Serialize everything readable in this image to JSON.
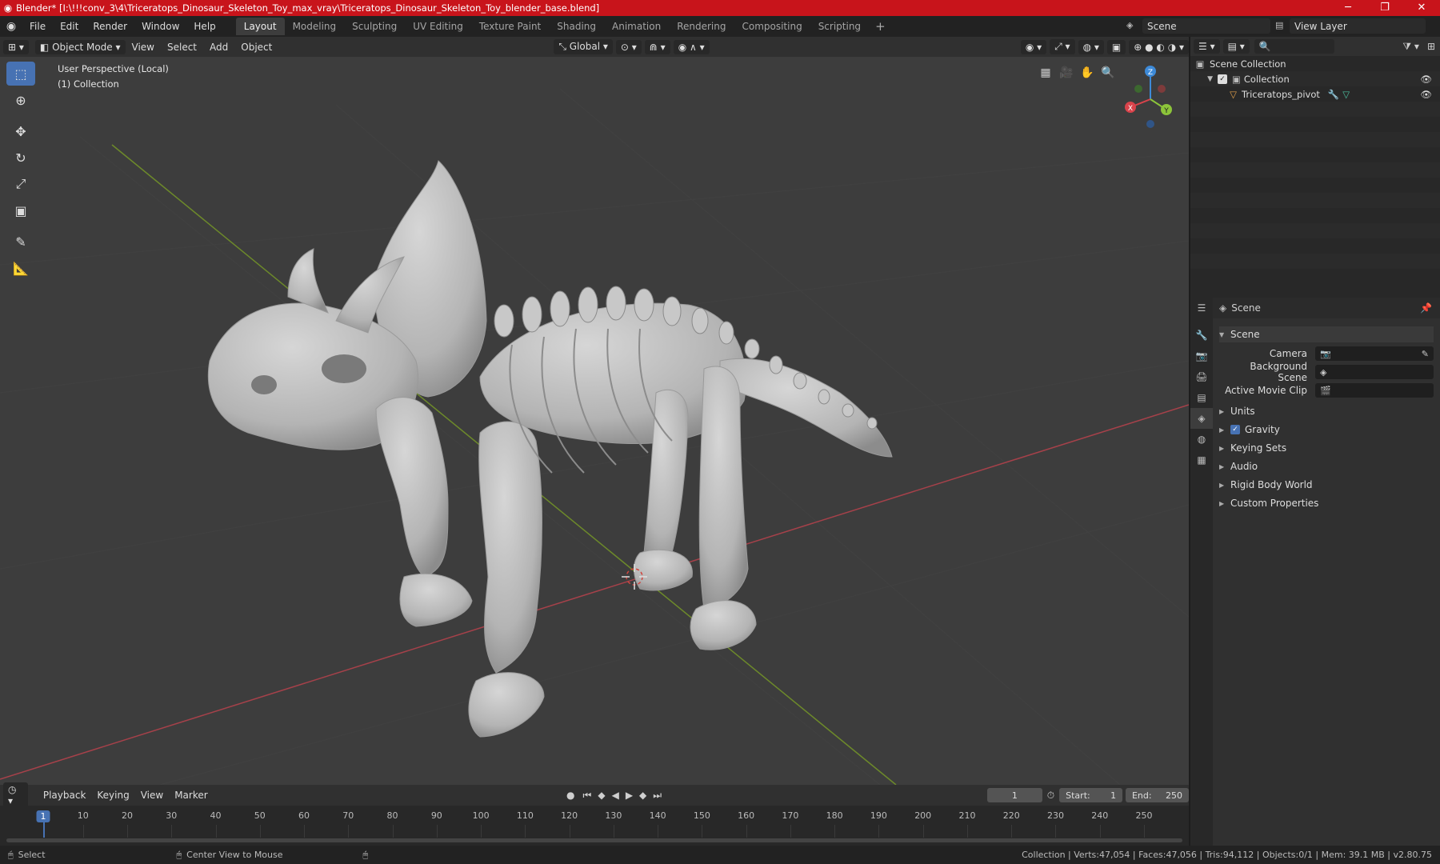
{
  "titlebar": {
    "title": "Blender* [I:\\!!!conv_3\\4\\Triceratops_Dinosaur_Skeleton_Toy_max_vray\\Triceratops_Dinosaur_Skeleton_Toy_blender_base.blend]",
    "minimize": "─",
    "maximize": "❐",
    "close": "✕"
  },
  "menu": {
    "items": [
      "File",
      "Edit",
      "Render",
      "Window",
      "Help"
    ],
    "workspaces": [
      "Layout",
      "Modeling",
      "Sculpting",
      "UV Editing",
      "Texture Paint",
      "Shading",
      "Animation",
      "Rendering",
      "Compositing",
      "Scripting"
    ],
    "active_workspace": "Layout",
    "add": "+",
    "scene": "Scene",
    "view_layer": "View Layer"
  },
  "viewport_header": {
    "mode": "Object Mode",
    "menus": [
      "View",
      "Select",
      "Add",
      "Object"
    ],
    "orientation": "Global"
  },
  "viewport": {
    "perspective": "User Perspective (Local)",
    "collection": "(1) Collection",
    "axes": {
      "x": "X",
      "y": "Y",
      "z": "Z"
    }
  },
  "timeline": {
    "menus": [
      "Playback",
      "Keying",
      "View",
      "Marker"
    ],
    "current_frame": "1",
    "start_label": "Start:",
    "start": "1",
    "end_label": "End:",
    "end": "250",
    "ticks": [
      "1",
      "10",
      "20",
      "30",
      "40",
      "50",
      "60",
      "70",
      "80",
      "90",
      "100",
      "110",
      "120",
      "130",
      "140",
      "150",
      "160",
      "170",
      "180",
      "190",
      "200",
      "210",
      "220",
      "230",
      "240",
      "250"
    ]
  },
  "outliner": {
    "scene_collection": "Scene Collection",
    "collection": "Collection",
    "object": "Triceratops_pivot"
  },
  "properties": {
    "header": "Scene",
    "panel": "Scene",
    "camera_label": "Camera",
    "background_label": "Background Scene",
    "movie_clip_label": "Active Movie Clip",
    "subpanels": [
      "Units",
      "Gravity",
      "Keying Sets",
      "Audio",
      "Rigid Body World",
      "Custom Properties"
    ]
  },
  "status": {
    "select": "Select",
    "center": "Center View to Mouse",
    "stats": "Collection | Verts:47,054 | Faces:47,056 | Tris:94,112 | Objects:0/1 | Mem: 39.1 MB | v2.80.75"
  },
  "colors": {
    "titlebar": "#c8141b",
    "accent": "#4772b3",
    "x_axis": "#d9434b",
    "y_axis": "#8cc43a",
    "z_axis": "#3d8ad8",
    "bone": "#c6c6c6"
  }
}
